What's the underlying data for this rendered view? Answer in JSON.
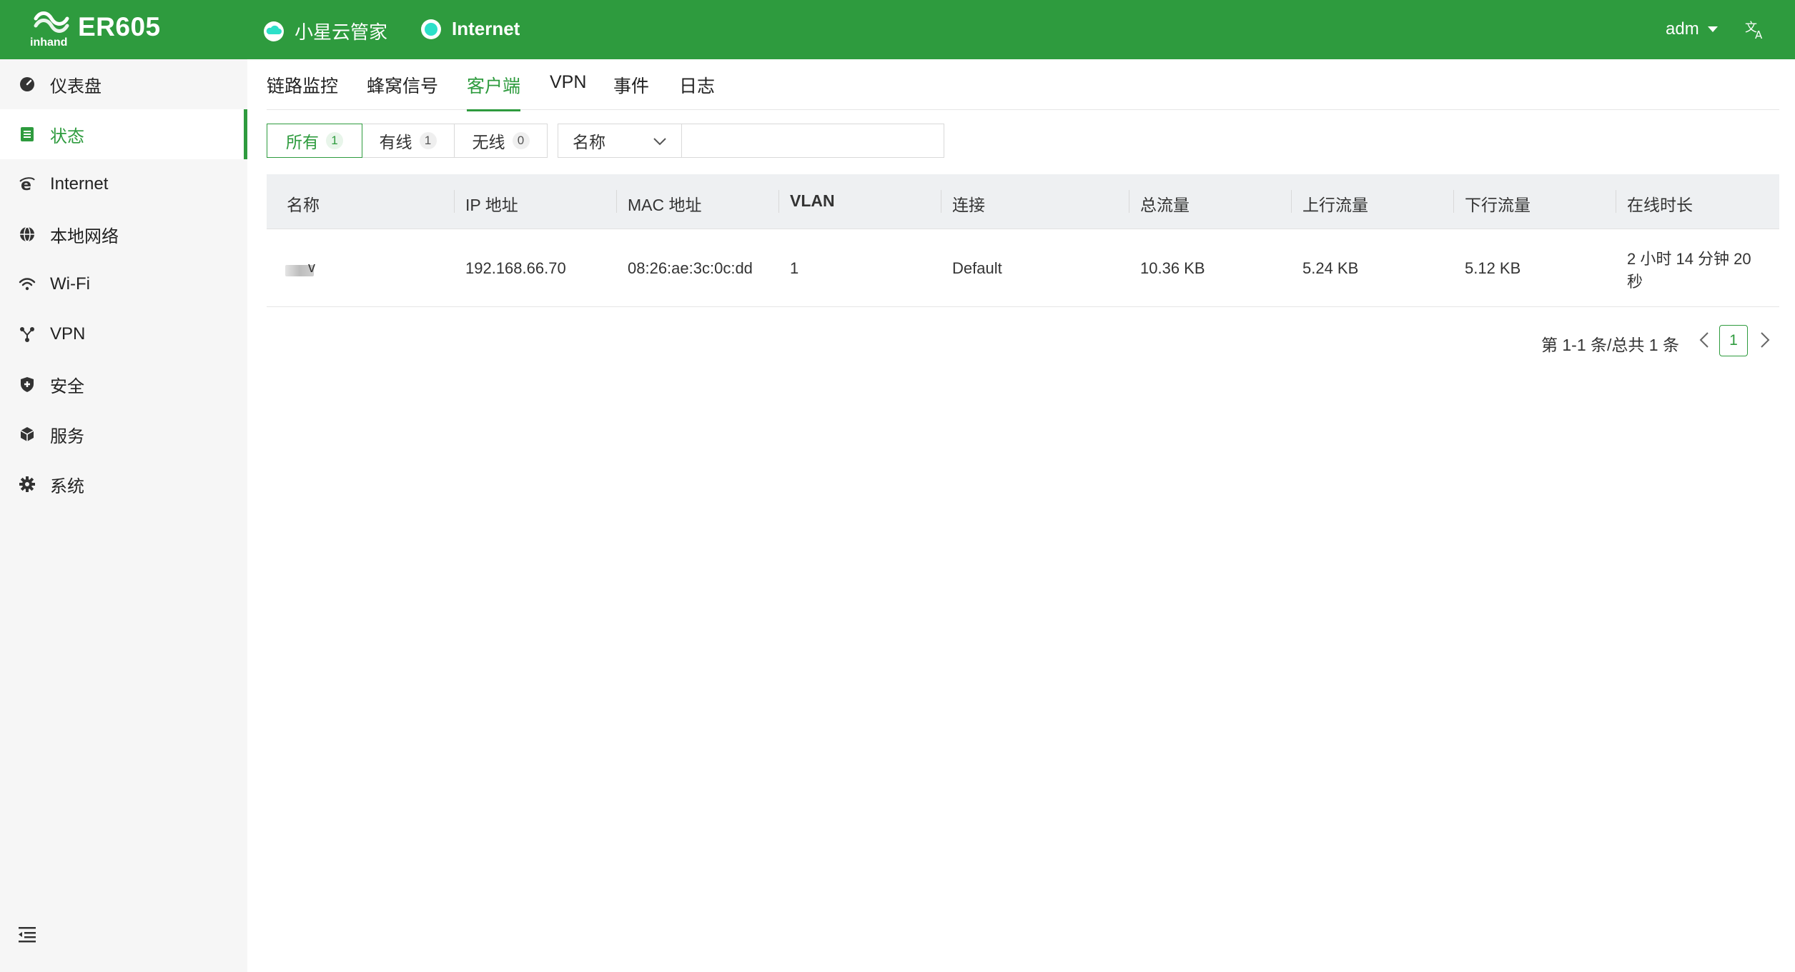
{
  "header": {
    "model": "ER605",
    "cloud_label": "小星云管家",
    "internet_label": "Internet",
    "user": "adm"
  },
  "sidebar": {
    "items": [
      {
        "label": "仪表盘",
        "icon": "dashboard-icon"
      },
      {
        "label": "状态",
        "icon": "status-list-icon"
      },
      {
        "label": "Internet",
        "icon": "internet-explorer-icon"
      },
      {
        "label": "本地网络",
        "icon": "globe-icon"
      },
      {
        "label": "Wi-Fi",
        "icon": "wifi-icon"
      },
      {
        "label": "VPN",
        "icon": "vpn-nodes-icon"
      },
      {
        "label": "安全",
        "icon": "shield-plus-icon"
      },
      {
        "label": "服务",
        "icon": "cube-icon"
      },
      {
        "label": "系统",
        "icon": "gear-icon"
      }
    ],
    "active": "状态"
  },
  "tabs": [
    "链路监控",
    "蜂窝信号",
    "客户端",
    "VPN",
    "事件",
    "日志"
  ],
  "active_tab": "客户端",
  "filters": {
    "segments": [
      {
        "label": "所有",
        "count": "1"
      },
      {
        "label": "有线",
        "count": "1"
      },
      {
        "label": "无线",
        "count": "0"
      }
    ],
    "select_value": "名称",
    "search_value": ""
  },
  "table": {
    "columns": [
      "名称",
      "IP 地址",
      "MAC 地址",
      "VLAN",
      "连接",
      "总流量",
      "上行流量",
      "下行流量",
      "在线时长"
    ],
    "rows": [
      {
        "name": "v",
        "ip": "192.168.66.70",
        "mac": "08:26:ae:3c:0c:dd",
        "vlan": "1",
        "connection": "Default",
        "total": "10.36 KB",
        "up": "5.24 KB",
        "down": "5.12 KB",
        "online_line1": "2 小时 14 分钟 20",
        "online_line2": "秒"
      }
    ]
  },
  "pagination": {
    "summary": "第 1-1 条/总共 1 条",
    "current_page": "1"
  },
  "colors": {
    "brand": "#2e9b3e",
    "status_online": "#2de0c9"
  }
}
